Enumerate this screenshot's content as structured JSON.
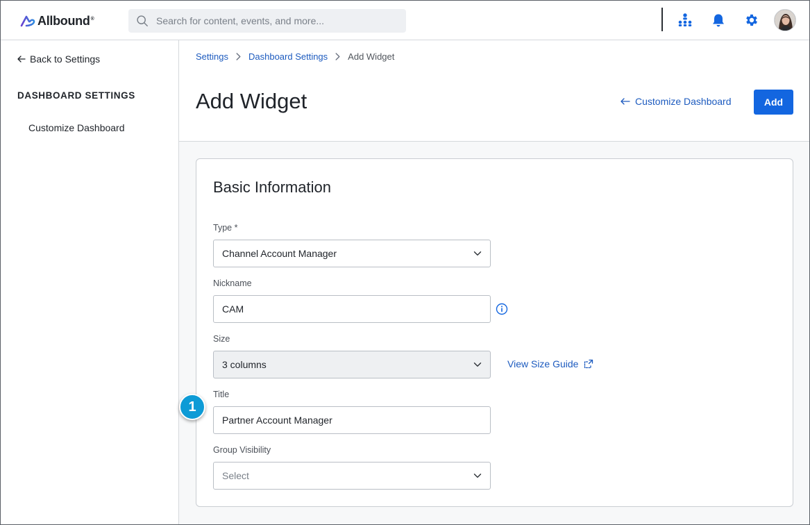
{
  "app": {
    "brand_name": "Allbound",
    "brand_mark": "®"
  },
  "search": {
    "placeholder": "Search for content, events, and more..."
  },
  "topbar_icons": [
    "org-chart-icon",
    "bell-icon",
    "gear-icon",
    "avatar"
  ],
  "sidebar": {
    "back_label": "Back to Settings",
    "heading": "DASHBOARD SETTINGS",
    "items": [
      {
        "label": "Customize Dashboard"
      }
    ]
  },
  "breadcrumb": {
    "items": [
      "Settings",
      "Dashboard Settings"
    ],
    "current": "Add Widget"
  },
  "header": {
    "title": "Add Widget",
    "back_link": "Customize Dashboard",
    "add_label": "Add"
  },
  "form": {
    "section_title": "Basic Information",
    "type": {
      "label": "Type *",
      "value": "Channel Account Manager"
    },
    "nickname": {
      "label": "Nickname",
      "value": "CAM"
    },
    "size": {
      "label": "Size",
      "value": "3 columns",
      "guide_link": "View Size Guide"
    },
    "title": {
      "label": "Title",
      "value": "Partner Account Manager"
    },
    "group_visibility": {
      "label": "Group Visibility",
      "placeholder": "Select"
    }
  },
  "annotation": {
    "step_number": "1"
  },
  "colors": {
    "accent": "#1366e0",
    "link": "#1d5bbf",
    "step_badge": "#0e9bd6",
    "brand_gradient_start": "#6a3fd0",
    "brand_gradient_end": "#2f8ce0"
  }
}
